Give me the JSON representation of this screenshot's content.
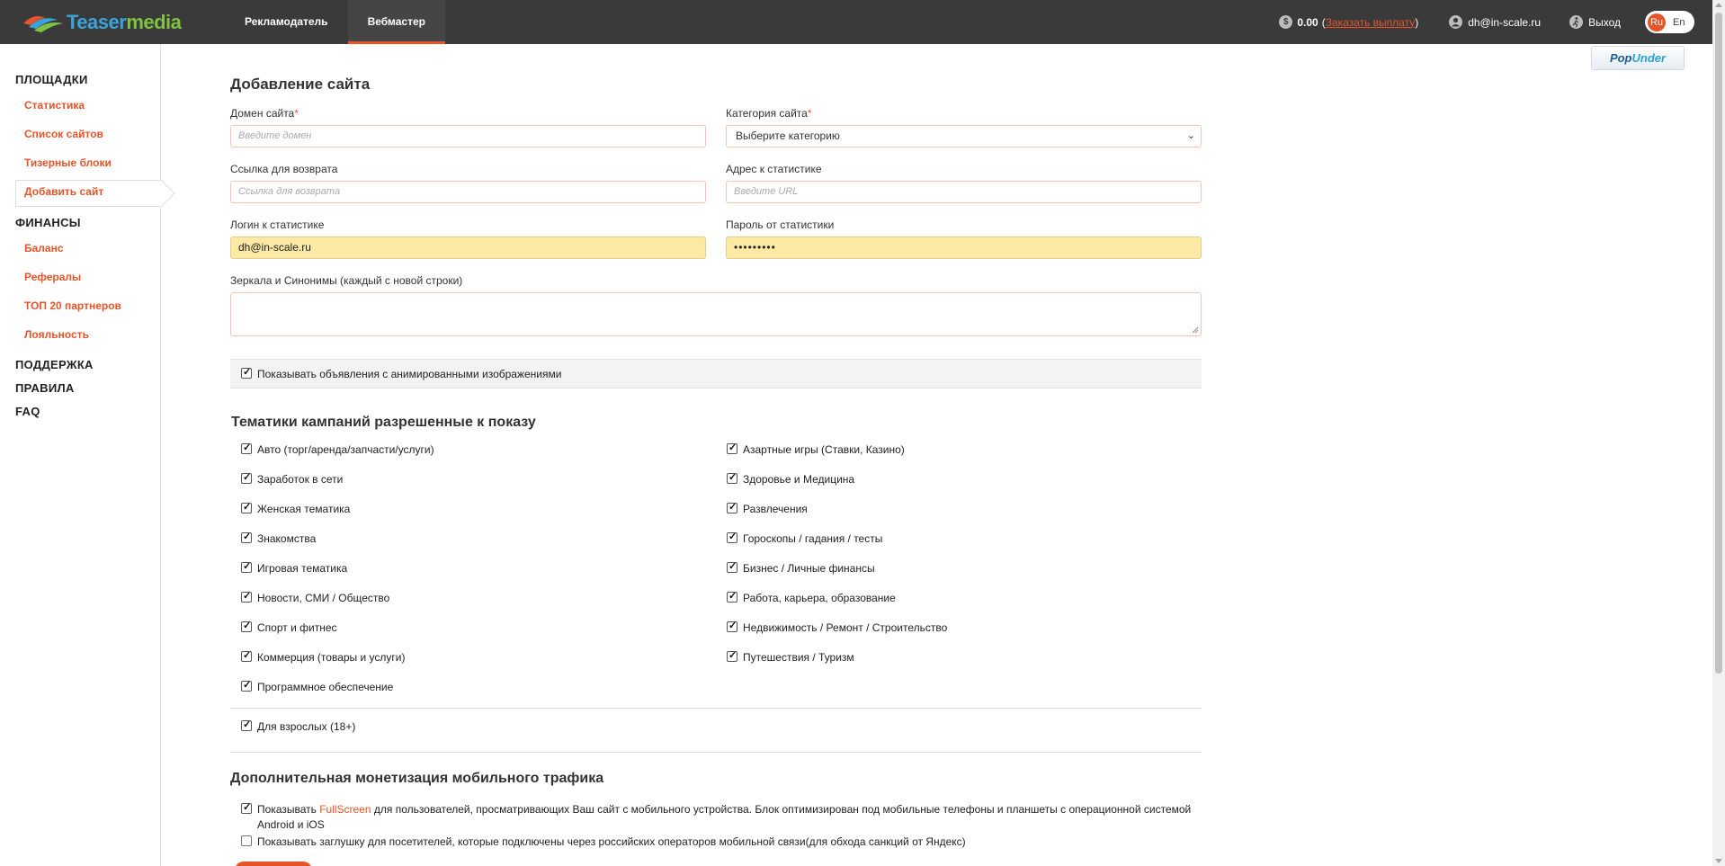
{
  "header": {
    "logo_part1": "Teaser",
    "logo_part2": "media",
    "nav": [
      {
        "label": "Рекламодатель"
      },
      {
        "label": "Вебмастер"
      }
    ],
    "balance_value": "0.00",
    "payout_link": "Заказать выплату",
    "user_email": "dh@in-scale.ru",
    "logout_label": "Выход",
    "lang_ru": "Ru",
    "lang_en": "En",
    "dollar_icon": "$"
  },
  "sidebar": {
    "sections": {
      "platforms": "ПЛОЩАДКИ",
      "finance": "ФИНАНСЫ",
      "support": "ПОДДЕРЖКА",
      "rules": "ПРАВИЛА",
      "faq": "FAQ"
    },
    "platform_links": [
      "Статистика",
      "Список сайтов",
      "Тизерные блоки",
      "Добавить сайт"
    ],
    "finance_links": [
      "Баланс",
      "Рефералы",
      "ТОП 20 партнеров",
      "Лояльность"
    ]
  },
  "popunder_badge": {
    "part1": "Pop",
    "part2": "Under"
  },
  "form": {
    "title": "Добавление сайта",
    "domain_label": "Домен сайта",
    "domain_placeholder": "Введите домен",
    "category_label": "Категория сайта",
    "category_value": "Выберите категорию",
    "return_link_label": "Ссылка для возврата",
    "return_link_placeholder": "Ссылка для возврата",
    "stats_url_label": "Адрес к статистике",
    "stats_url_placeholder": "Введите URL",
    "stats_login_label": "Логин к статистике",
    "stats_login_value": "dh@in-scale.ru",
    "stats_password_label": "Пароль от статистики",
    "stats_password_value": "•••••••••",
    "mirrors_label": "Зеркала и Синонимы (каждый с новой строки)",
    "animated_ads_label": "Показывать объявления с анимированными изображениями",
    "required_mark": "*"
  },
  "topics": {
    "title": "Тематики кампаний разрешенные к показу",
    "left": [
      "Авто (торг/аренда/запчасти/услуги)",
      "Заработок в сети",
      "Женская тематика",
      "Знакомства",
      "Игровая тематика",
      "Новости, СМИ / Общество",
      "Спорт и фитнес",
      "Коммерция (товары и услуги)",
      "Программное обеспечение"
    ],
    "right": [
      "Азартные игры (Ставки, Казино)",
      "Здоровье и Медицина",
      "Развлечения",
      "Гороскопы / гадания / тесты",
      "Бизнес / Личные финансы",
      "Работа, карьера, образование",
      "Недвижимость / Ремонт / Строительство",
      "Путешествия / Туризм"
    ],
    "adult": "Для взрослых (18+)"
  },
  "mobile": {
    "title": "Дополнительная монетизация мобильного трафика",
    "fullscreen_prefix": "Показывать ",
    "fullscreen_link": "FullScreen",
    "fullscreen_suffix": " для пользователей, просматривающих Ваш сайт с мобильного устройства. Блок оптимизирован под мобильные телефоны и планшеты с операционной системой",
    "fullscreen_line2": "Android и iOS",
    "stub_label": "Показывать заглушку для посетителей, которые подключены через российских операторов мобильной связи(для обхода санкций от Яндекс)"
  }
}
